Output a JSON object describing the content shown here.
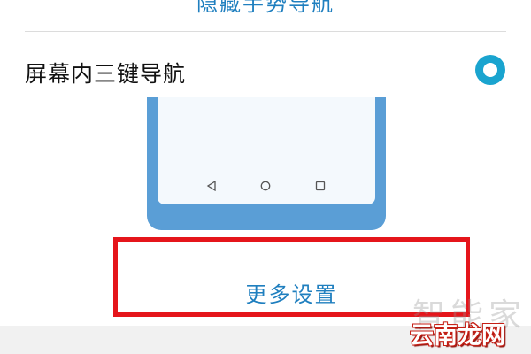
{
  "settings": {
    "gesture_option_label": "隐藏手势导航",
    "three_key_option_label": "屏幕内三键导航",
    "three_key_option_selected": true,
    "more_settings_label": "更多设置"
  },
  "watermark": {
    "line1": "智能家",
    "line2": "云南龙网"
  },
  "colors": {
    "accent": "#1aa4cf",
    "link_text": "#1f7fbf",
    "highlight_box": "#e5151b",
    "phone_body": "#5a9ed6"
  },
  "icons": {
    "nav_back": "triangle-left",
    "nav_home": "circle",
    "nav_recent": "square"
  }
}
